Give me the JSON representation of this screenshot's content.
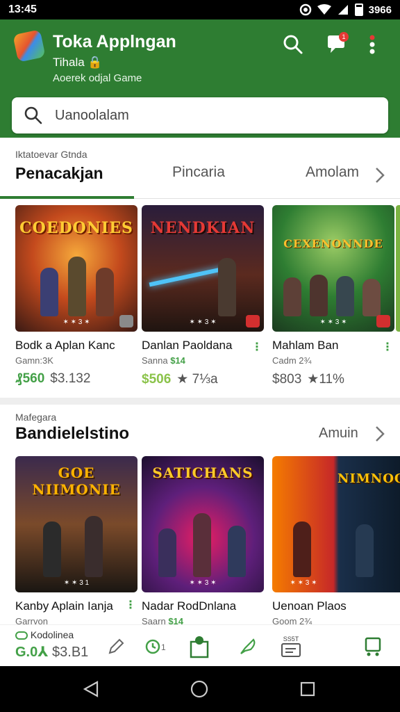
{
  "status": {
    "time": "13:45",
    "battery_text": "3966"
  },
  "app": {
    "title": "Toka Applngan",
    "subtitle": "Tihala 🔒",
    "tagline": "Aoerek odjal Game"
  },
  "header": {
    "notif_count": "1"
  },
  "search": {
    "placeholder": "Uanoolalam"
  },
  "tabs": {
    "overline": "Iktatoevar Gtnda",
    "items": [
      "Penacakjan",
      "Pincaria",
      "Amolam"
    ]
  },
  "section1": {
    "cards": [
      {
        "cover_title": "COEDONIES",
        "name": "Bodk a Aplan Kanc",
        "meta_prefix": "Gamn:",
        "meta_value": "3K",
        "price_primary": "₰560",
        "price_secondary": "$3.132"
      },
      {
        "cover_title": "NENDKIAN",
        "name": "Danlan Paoldana",
        "meta_prefix": "Sanna ",
        "meta_value": "$14",
        "price_primary": "$506",
        "price_secondary": "★ 7⅓a"
      },
      {
        "cover_title": "CEXENONNDE",
        "name": "Mahlam Ban",
        "meta_prefix": "Cadm ",
        "meta_value": "2¾",
        "price_primary": "$803",
        "price_secondary": "★11%"
      }
    ]
  },
  "section2": {
    "overline": "Mafegara",
    "title": "Bandielelstino",
    "more": "Amuin",
    "cards": [
      {
        "cover_title": "GOE NIIMONIE",
        "name": "Kanby Aplain Ianja",
        "meta_prefix": "Garrvon",
        "meta_value": ""
      },
      {
        "cover_title": "SATICHANS",
        "name": "Nadar RodDnlana",
        "meta_prefix": "Saarn ",
        "meta_value": "$14"
      },
      {
        "cover_title": "NIMNOON",
        "name": "Uenoan Plaos",
        "meta_prefix": "Goom ",
        "meta_value": "2¾"
      }
    ]
  },
  "bottom": {
    "overline": "Kodolinea",
    "price_primary": "G.0⅄",
    "price_secondary": "$3.B1",
    "nav4_label": "SS5T"
  },
  "colors": {
    "primary": "#2e7d32",
    "accent_green": "#43a047",
    "badge_red": "#e53935"
  }
}
